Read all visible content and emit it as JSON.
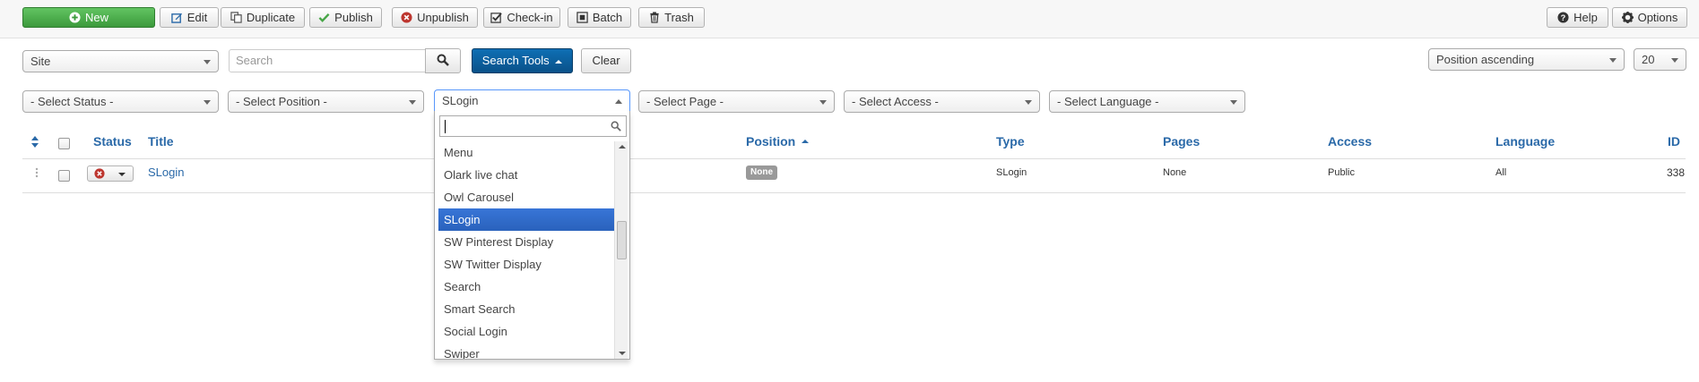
{
  "toolbar": {
    "new": "New",
    "edit": "Edit",
    "duplicate": "Duplicate",
    "publish": "Publish",
    "unpublish": "Unpublish",
    "checkin": "Check-in",
    "batch": "Batch",
    "trash": "Trash",
    "help": "Help",
    "options": "Options"
  },
  "filters": {
    "client": "Site",
    "search_placeholder": "Search",
    "search_tools": "Search Tools",
    "clear": "Clear",
    "ordering": "Position ascending",
    "limit": "20",
    "status": "- Select Status -",
    "position": "- Select Position -",
    "type": "SLogin",
    "page": "- Select Page -",
    "access": "- Select Access -",
    "language": "- Select Language -"
  },
  "dropdown": {
    "items": [
      "Menu",
      "Olark live chat",
      "Owl Carousel",
      "SLogin",
      "SW Pinterest Display",
      "SW Twitter Display",
      "Search",
      "Smart Search",
      "Social Login",
      "Swiper"
    ],
    "selected_index": 3
  },
  "table": {
    "headers": {
      "status": "Status",
      "title": "Title",
      "position": "Position",
      "type": "Type",
      "pages": "Pages",
      "access": "Access",
      "language": "Language",
      "id": "ID"
    },
    "rows": [
      {
        "title": "SLogin",
        "position": "None",
        "type": "SLogin",
        "pages": "None",
        "access": "Public",
        "language": "All",
        "id": "338"
      }
    ]
  },
  "colors": {
    "accent": "#2a69a8",
    "success": "#46a546",
    "primary": "#0d5b9a",
    "danger": "#bd362f",
    "selected": "#3875d7"
  }
}
